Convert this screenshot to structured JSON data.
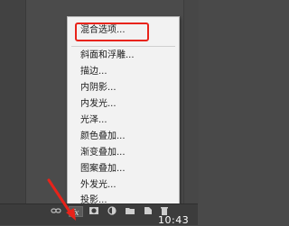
{
  "menu": {
    "header_item": "混合选项...",
    "items": [
      "斜面和浮雕...",
      "描边...",
      "内阴影...",
      "内发光...",
      "光泽...",
      "颜色叠加...",
      "渐变叠加...",
      "图案叠加...",
      "外发光...",
      "投影..."
    ]
  },
  "toolbar": {
    "icons": [
      "link-icon",
      "fx-icon",
      "mask-icon",
      "adjustment-icon",
      "folder-icon",
      "new-layer-icon",
      "trash-icon"
    ]
  },
  "clock": {
    "time": "10:43"
  },
  "colors": {
    "highlight": "#e8231a",
    "menu_bg": "#f2f2f2",
    "panel_bg": "#4b4b4b"
  }
}
